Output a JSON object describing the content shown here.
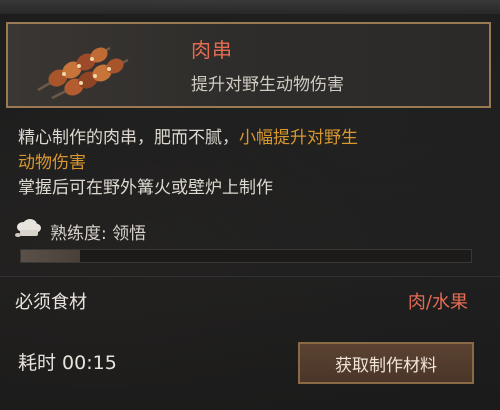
{
  "item": {
    "name": "肉串",
    "subtitle": "提升对野生动物伤害",
    "icon": "meat-skewer-icon"
  },
  "description": {
    "line1_normal": "精心制作的肉串，肥而不腻，",
    "line1_highlight": "小幅提升对野生",
    "line2_highlight": "动物伤害",
    "line3": "掌握后可在野外篝火或壁炉上制作"
  },
  "mastery": {
    "label": "熟练度: 领悟",
    "progress_fraction": 0.13,
    "icon": "chef-hat-icon"
  },
  "ingredients": {
    "label": "必须食材",
    "value": "肉/水果"
  },
  "time_label": "耗时 00:15",
  "actions": {
    "get_materials": "获取制作材料"
  },
  "colors": {
    "accent_red": "#e36b52",
    "accent_orange": "#d9972f",
    "frame_gold": "#9a7a52"
  }
}
